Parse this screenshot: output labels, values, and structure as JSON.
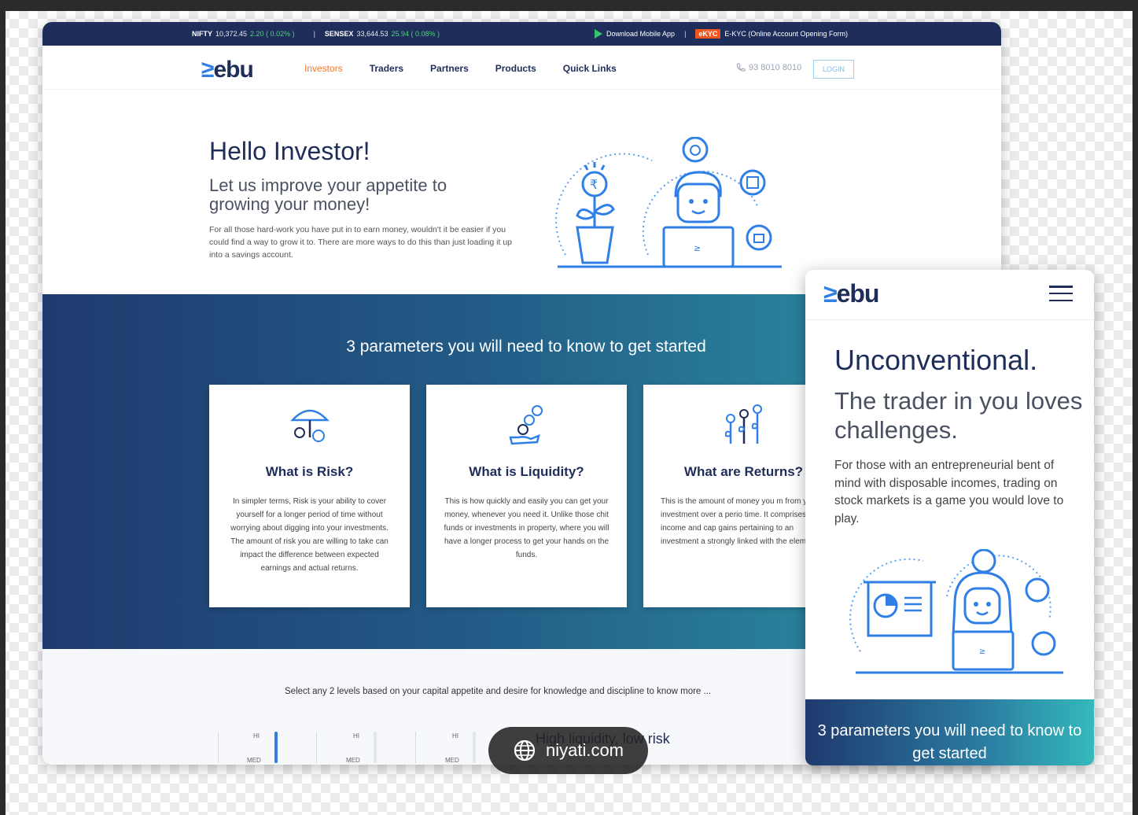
{
  "ticker": {
    "nifty_label": "NIFTY",
    "nifty_value": "10,372.45",
    "nifty_change": "2.20 ( 0.02% )",
    "separator": "|",
    "sensex_label": "SENSEX",
    "sensex_value": "33,644.53",
    "sensex_change": "25.94 ( 0.08% )",
    "download_app": "Download Mobile App",
    "ekyc_badge": "eKYC",
    "ekyc_text": "E-KYC (Online Account Opening Form)"
  },
  "nav": {
    "logo_mark": "≥",
    "logo_text": "ebu",
    "links": [
      "Investors",
      "Traders",
      "Partners",
      "Products",
      "Quick Links"
    ],
    "phone": "93 8010 8010",
    "login": "LOGIN"
  },
  "hero": {
    "title": "Hello Investor!",
    "subtitle": "Let us improve your appetite to growing your money!",
    "body": "For all those hard-work you have put in to earn money, wouldn't it be easier if you could find a way to grow it to. There are more ways to do this than just loading it up into a savings account."
  },
  "band": {
    "title": "3 parameters you will need to know to get started",
    "cards": [
      {
        "title": "What is Risk?",
        "body": "In simpler terms, Risk is your ability to cover yourself for a longer period of time without worrying about digging into your investments. The amount of risk you are willing to take can impact the difference between expected earnings and actual returns."
      },
      {
        "title": "What is Liquidity?",
        "body": "This is how quickly and easily you can get your money, whenever you need it. Unlike those chit funds or investments in property, where you will have a longer process to get your hands on the funds."
      },
      {
        "title": "What are Returns?",
        "body": "This is the amount of money you m from your investment over a perio time. It comprises income and cap gains pertaining to an investment a strongly linked with the element of"
      }
    ]
  },
  "levels": {
    "instruction": "Select any 2 levels based on your capital appetite and desire for knowledge and discipline to know more ...",
    "hi": "HI",
    "med": "MED",
    "risk_label": "High liquidity, low risk"
  },
  "mobile": {
    "logo_mark": "≥",
    "logo_text": "ebu",
    "title": "Unconventional.",
    "subtitle": "The trader in you loves challenges.",
    "body": "For those with an entrepreneurial bent of mind with disposable incomes, trading on stock markets is a game you would love to play.",
    "band_text": "3 parameters you will need to know to get started"
  },
  "overlay": {
    "site": "niyati.com"
  },
  "colors": {
    "navy": "#1f2d5a",
    "accent_blue": "#2f7fe6",
    "orange": "#f07a2a",
    "teal": "#2d98a8"
  }
}
